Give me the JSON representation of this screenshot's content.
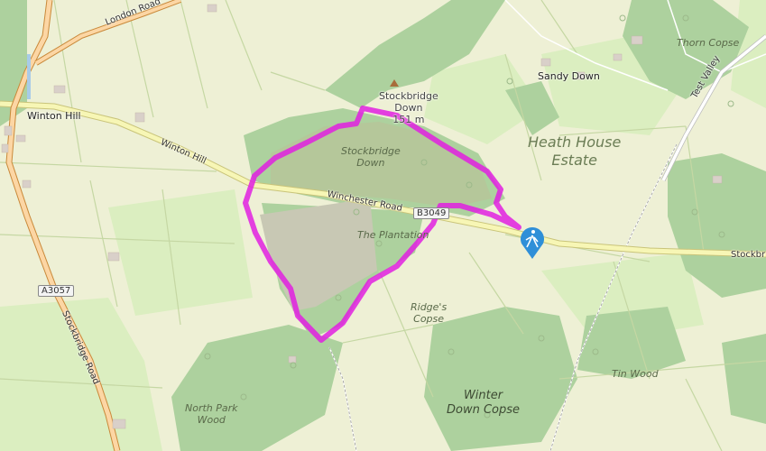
{
  "map": {
    "places": {
      "winton_hill": "Winton Hill",
      "sandy_down": "Sandy Down",
      "stockbridge_down_peak": "Stockbridge\nDown\n151 m"
    },
    "areas": {
      "heath_house_estate": "Heath House\nEstate",
      "thorn_copse": "Thorn Copse",
      "stockbridge_down": "Stockbridge\nDown",
      "the_plantation": "The Plantation",
      "ridges_copse": "Ridge's\nCopse",
      "tin_wood": "Tin Wood",
      "winter_down_copse": "Winter\nDown Copse",
      "north_park_wood": "North Park\nWood"
    },
    "roads": {
      "london_road": "London Road",
      "winton_hill_road": "Winton Hill",
      "winchester_road": "Winchester Road",
      "b3049": "B3049",
      "a3057": "A3057",
      "stockbridge_road": "Stockbridge Road",
      "test_valley": "Test Valley",
      "stockbr": "Stockbr"
    },
    "route_color": "#e020e0",
    "marker_icon": "hiker-icon"
  }
}
